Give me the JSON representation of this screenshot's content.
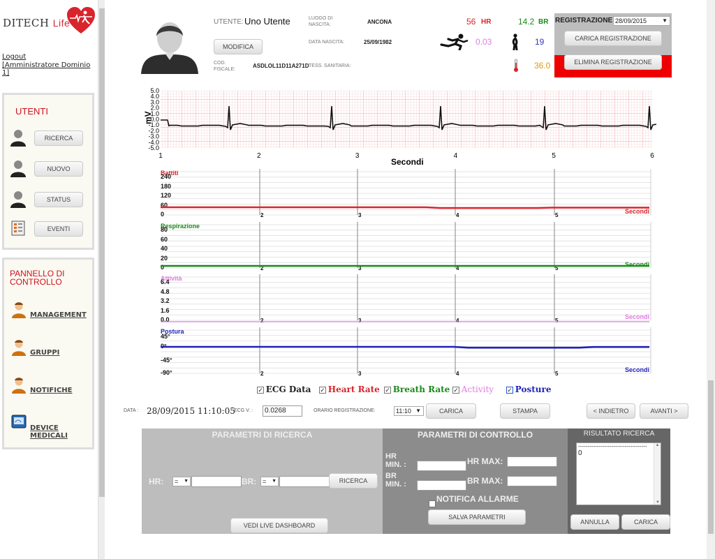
{
  "app": {
    "brand_main": "DITECH",
    "brand_sub": "Life"
  },
  "sidebar": {
    "logout": "Logout",
    "admin": "[Amministratore Dominio 1]",
    "utenti_title": "UTENTI",
    "utenti_buttons": [
      "RICERCA",
      "NUOVO",
      "STATUS",
      "EVENTI"
    ],
    "panel_title_line1": "PANNELLO DI",
    "panel_title_line2": "CONTROLLO",
    "panel_links": [
      "MANAGEMENT",
      "GRUPPI",
      "NOTIFICHE",
      "DEVICE MEDICALI"
    ]
  },
  "header": {
    "utente_label": "UTENTE:",
    "utente_value": "Uno Utente",
    "modifica": "MODIFICA",
    "cod_fiscale_label_1": "COD.",
    "cod_fiscale_label_2": "FISCALE:",
    "cod_fiscale_value": "ASDLOL11D11A271D",
    "tess_label": "TESS. SANITARIA:",
    "luogo_label_1": "LUOGO DI",
    "luogo_label_2": "NASCITA:",
    "luogo_value": "ANCONA",
    "data_nascita_label": "DATA NASCITA:",
    "data_nascita_value": "25/09/1982",
    "hr_value": "56",
    "hr_unit": "HR",
    "br_value": "14.2",
    "br_unit": "BR",
    "activity_value": "0.03",
    "posture_value": "19",
    "temp_value": "36.0",
    "registrazione_label": "REGISTRAZIONE:",
    "registrazione_value": "28/09/2015",
    "carica_registrazione": "CARICA REGISTRAZIONE",
    "elimina_registrazione": "ELIMINA REGISTRAZIONE",
    "colors": {
      "hr": "#d8242c",
      "br": "#1a8a1a",
      "activity": "#e07be0",
      "posture": "#3333cc",
      "temp": "#e09a10",
      "danger": "#ee0000"
    }
  },
  "ecg": {
    "y_label": "mV",
    "x_label": "Secondi",
    "y_ticks": [
      "5.0",
      "4.0",
      "3.0",
      "2.0",
      "1.0",
      "0.0",
      "-1.0",
      "-2.0",
      "-3.0",
      "-4.0",
      "-5.0"
    ],
    "x_ticks": [
      "1",
      "2",
      "3",
      "4",
      "5",
      "6"
    ]
  },
  "charts": [
    {
      "name": "heart",
      "title": "Battiti",
      "color": "#d8242c",
      "ticks": [
        "240",
        "180",
        "120",
        "60",
        "0"
      ],
      "x_unit": "Secondi",
      "x_ticks": [
        "2",
        "3",
        "4",
        "5"
      ]
    },
    {
      "name": "breath",
      "title": "Respirazione",
      "color": "#1a8a1a",
      "ticks": [
        "80",
        "60",
        "40",
        "20",
        "0"
      ],
      "x_unit": "Secondi",
      "x_ticks": [
        "2",
        "3",
        "4",
        "5"
      ]
    },
    {
      "name": "activity",
      "title": "Attività",
      "color": "#e07be0",
      "ticks": [
        "6.4",
        "4.8",
        "3.2",
        "1.6",
        "0.0"
      ],
      "x_unit": "Secondi",
      "x_ticks": [
        "2",
        "3",
        "4",
        "5"
      ]
    },
    {
      "name": "posture",
      "title": "Postura",
      "color": "#2222bb",
      "ticks": [
        "45°",
        "0°",
        "-45°",
        "-90°"
      ],
      "x_unit": "Secondi",
      "x_ticks": [
        "2",
        "3",
        "4",
        "5"
      ]
    }
  ],
  "legend": {
    "ecg": "ECG Data",
    "hr": "Heart Rate",
    "br": "Breath Rate",
    "activity": "Activity",
    "posture": "Posture"
  },
  "controls": {
    "data_label": "DATA :",
    "data_value": "28/09/2015 11:10:05",
    "ecg_v_label": "ECG V. :",
    "ecg_v_value": "0.0268",
    "orario_label": "ORARIO REGISTRAZIONE:",
    "orario_value": "11:10",
    "carica": "CARICA",
    "stampa": "STAMPA",
    "indietro": "< INDIETRO",
    "avanti": "AVANTI >"
  },
  "ricerca": {
    "title": "PARAMETRI DI RICERCA",
    "hr_label": "HR:",
    "br_label": "BR:",
    "op_value": "=",
    "ricerca_button": "RICERCA",
    "live_button": "VEDI LIVE DASHBOARD"
  },
  "controllo": {
    "title": "PARAMETRI DI CONTROLLO",
    "hr_min_1": "HR",
    "hr_min_2": "MIN. :",
    "hr_max": "HR MAX:",
    "br_min_1": "BR",
    "br_min_2": "MIN. :",
    "br_max": "BR MAX:",
    "notifica": "NOTIFICA ALLARME",
    "salva": "SALVA PARAMETRI"
  },
  "risultato": {
    "title": "RISULTATO RICERCA",
    "dashes": "-------------------------------------",
    "value": "0",
    "annulla": "ANNULLA",
    "carica": "CARICA"
  }
}
